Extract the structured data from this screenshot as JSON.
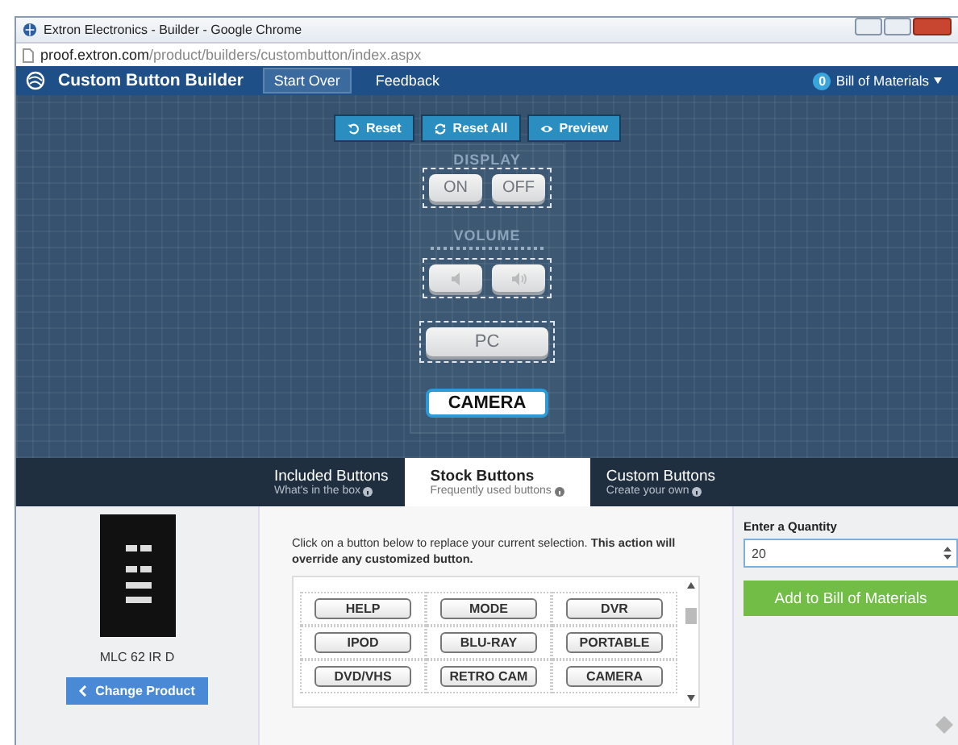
{
  "window": {
    "title": "Extron Electronics - Builder - Google Chrome",
    "url_host": "proof.extron.com",
    "url_path": "/product/builders/custombutton/index.aspx"
  },
  "navbar": {
    "title": "Custom Button Builder",
    "links": [
      {
        "label": "Start Over",
        "selected": true
      },
      {
        "label": "Feedback",
        "selected": false
      }
    ],
    "bom_count": "0",
    "bom_label": "Bill of Materials"
  },
  "toolbar": [
    {
      "label": "Reset",
      "kind": "reset"
    },
    {
      "label": "Reset All",
      "kind": "refresh"
    },
    {
      "label": "Preview",
      "kind": "eye"
    }
  ],
  "faceplate": [
    {
      "label": "DISPLAY",
      "buttons": [
        {
          "kind": "text",
          "label": "ON",
          "selected": false
        },
        {
          "kind": "text",
          "label": "OFF",
          "selected": false
        }
      ]
    },
    {
      "label": "VOLUME",
      "buttons": [
        {
          "kind": "volume-down",
          "selected": false
        },
        {
          "kind": "volume-up",
          "selected": false
        }
      ]
    },
    {
      "buttons": [
        {
          "kind": "text",
          "label": "PC",
          "selected": false
        }
      ]
    },
    {
      "buttons": [
        {
          "kind": "text",
          "label": "CAMERA",
          "selected": true
        }
      ]
    }
  ],
  "tabs": [
    {
      "title": "Included Buttons",
      "subtitle": "What's in the box",
      "selected": false
    },
    {
      "title": "Stock Buttons",
      "subtitle": "Frequently used buttons",
      "selected": true
    },
    {
      "title": "Custom Buttons",
      "subtitle": "Create your own",
      "selected": false
    }
  ],
  "product": {
    "name": "MLC 62 IR D",
    "change_button": "Change Product"
  },
  "stock": {
    "instructions": "Click on a button below to replace your current selection. **This action will override any customized button.**",
    "buttons": [
      "HELP",
      "MODE",
      "DVR",
      "IPOD",
      "BLU-RAY",
      "PORTABLE",
      "DVD/VHS",
      "RETRO CAM",
      "CAMERA"
    ]
  },
  "order": {
    "quantity_label": "Enter a Quantity",
    "quantity": "20",
    "add_button": "Add to Bill of Materials"
  }
}
